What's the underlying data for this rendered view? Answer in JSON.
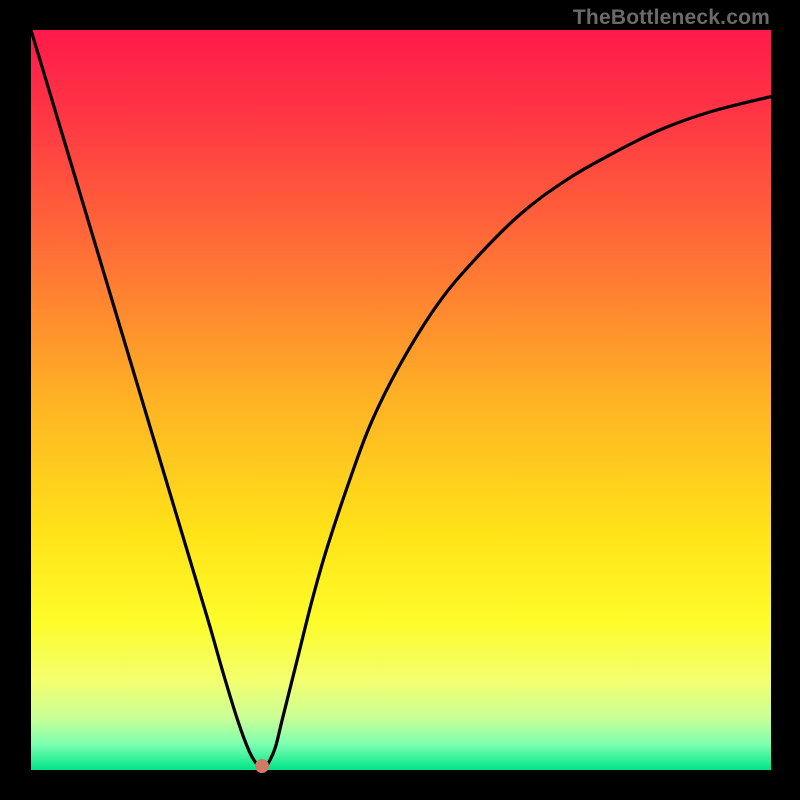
{
  "watermark": "TheBottleneck.com",
  "chart_data": {
    "type": "line",
    "title": "",
    "xlabel": "",
    "ylabel": "",
    "xlim": [
      0,
      100
    ],
    "ylim": [
      0,
      100
    ],
    "grid": false,
    "legend": false,
    "gradient_stops": [
      {
        "offset": 0.0,
        "color": "#ff1a4b"
      },
      {
        "offset": 0.12,
        "color": "#ff3744"
      },
      {
        "offset": 0.3,
        "color": "#ff6f36"
      },
      {
        "offset": 0.5,
        "color": "#ffb224"
      },
      {
        "offset": 0.68,
        "color": "#ffe318"
      },
      {
        "offset": 0.8,
        "color": "#fdfc2a"
      },
      {
        "offset": 0.88,
        "color": "#f3ff6f"
      },
      {
        "offset": 0.93,
        "color": "#c9ff97"
      },
      {
        "offset": 0.965,
        "color": "#7dffb0"
      },
      {
        "offset": 1.0,
        "color": "#00e588"
      }
    ],
    "series": [
      {
        "name": "bottleneck-curve",
        "x": [
          0.0,
          3.0,
          6.0,
          9.0,
          12.0,
          15.0,
          18.0,
          21.0,
          24.0,
          26.0,
          28.0,
          29.5,
          30.5,
          31.0,
          31.5,
          32.0,
          33.0,
          34.0,
          36.0,
          38.0,
          40.0,
          43.0,
          46.0,
          50.0,
          55.0,
          60.0,
          66.0,
          72.0,
          78.0,
          85.0,
          92.0,
          100.0
        ],
        "values": [
          100.0,
          90.0,
          80.0,
          70.0,
          60.0,
          50.0,
          40.0,
          30.0,
          20.0,
          13.0,
          6.5,
          2.5,
          0.8,
          0.3,
          0.3,
          0.8,
          3.0,
          7.0,
          15.0,
          23.0,
          30.0,
          39.0,
          47.0,
          55.0,
          63.0,
          69.0,
          75.0,
          79.5,
          83.0,
          86.5,
          89.0,
          91.0
        ]
      }
    ],
    "marker": {
      "x": 31.2,
      "y": 0.5,
      "color": "#cf7a65"
    }
  }
}
